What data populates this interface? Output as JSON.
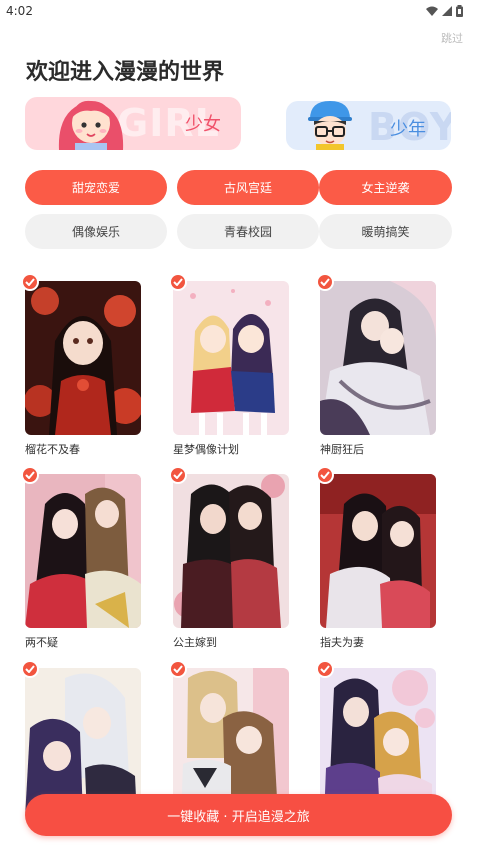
{
  "status_bar": {
    "time": "4:02",
    "icons": [
      "wifi-icon",
      "signal-icon",
      "battery-icon"
    ]
  },
  "header": {
    "skip_label": "跳过",
    "title": "欢迎进入漫漫的世界"
  },
  "gender": {
    "girl": {
      "label": "少女",
      "bg_text": "GIRL"
    },
    "boy": {
      "label": "少年",
      "bg_text": "BOY"
    }
  },
  "tags": [
    {
      "label": "甜宠恋爱",
      "selected": true
    },
    {
      "label": "古风宫廷",
      "selected": true
    },
    {
      "label": "女主逆袭",
      "selected": true
    },
    {
      "label": "偶像娱乐",
      "selected": false
    },
    {
      "label": "青春校园",
      "selected": false
    },
    {
      "label": "暖萌搞笑",
      "selected": false
    }
  ],
  "comics": [
    {
      "title": "榴花不及春",
      "checked": true
    },
    {
      "title": "星梦偶像计划",
      "checked": true
    },
    {
      "title": "神厨狂后",
      "checked": true
    },
    {
      "title": "两不疑",
      "checked": true
    },
    {
      "title": "公主嫁到",
      "checked": true
    },
    {
      "title": "指夫为妻",
      "checked": true
    },
    {
      "title": "",
      "checked": true
    },
    {
      "title": "",
      "checked": true
    },
    {
      "title": "",
      "checked": true
    }
  ],
  "footer": {
    "collect_label": "一键收藏 · 开启追漫之旅"
  },
  "colors": {
    "accent": "#fb5b47",
    "tag_inactive_bg": "#f1f1f1",
    "girl_bg": "#ffd7dc",
    "boy_bg": "#e2ecfb"
  }
}
